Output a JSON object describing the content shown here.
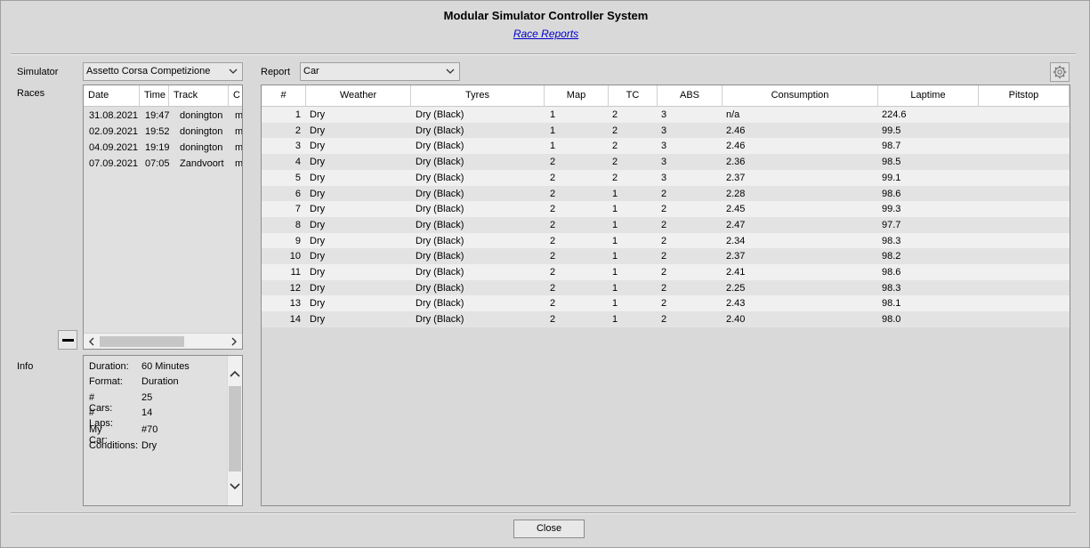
{
  "window": {
    "title": "Modular Simulator Controller System",
    "subtitle_link": "Race Reports"
  },
  "labels": {
    "simulator": "Simulator",
    "races": "Races",
    "info": "Info",
    "report": "Report"
  },
  "simulator_select": {
    "value": "Assetto Corsa Competizione"
  },
  "report_select": {
    "value": "Car"
  },
  "races": {
    "columns": [
      "Date",
      "Time",
      "Track",
      "C"
    ],
    "rows": [
      {
        "date": "31.08.2021",
        "time": "19:47",
        "track": "donington",
        "c": "m"
      },
      {
        "date": "02.09.2021",
        "time": "19:52",
        "track": "donington",
        "c": "m"
      },
      {
        "date": "04.09.2021",
        "time": "19:19",
        "track": "donington",
        "c": "m"
      },
      {
        "date": "07.09.2021",
        "time": "07:05",
        "track": "Zandvoort",
        "c": "m"
      }
    ]
  },
  "info": {
    "rows": [
      {
        "key": "Duration:",
        "value": "60 Minutes"
      },
      {
        "key": "Format:",
        "value": "Duration"
      },
      {
        "key": "# Cars:",
        "value": "25"
      },
      {
        "key": "# Laps:",
        "value": "14"
      },
      {
        "key": "My Car:",
        "value": "#70"
      },
      {
        "key": "Conditions:",
        "value": "Dry"
      }
    ]
  },
  "report_table": {
    "columns": [
      "#",
      "Weather",
      "Tyres",
      "Map",
      "TC",
      "ABS",
      "Consumption",
      "Laptime",
      "Pitstop"
    ],
    "rows": [
      [
        "1",
        "Dry",
        "Dry (Black)",
        "1",
        "2",
        "3",
        "n/a",
        "224.6",
        ""
      ],
      [
        "2",
        "Dry",
        "Dry (Black)",
        "1",
        "2",
        "3",
        "2.46",
        "99.5",
        ""
      ],
      [
        "3",
        "Dry",
        "Dry (Black)",
        "1",
        "2",
        "3",
        "2.46",
        "98.7",
        ""
      ],
      [
        "4",
        "Dry",
        "Dry (Black)",
        "2",
        "2",
        "3",
        "2.36",
        "98.5",
        ""
      ],
      [
        "5",
        "Dry",
        "Dry (Black)",
        "2",
        "2",
        "3",
        "2.37",
        "99.1",
        ""
      ],
      [
        "6",
        "Dry",
        "Dry (Black)",
        "2",
        "1",
        "2",
        "2.28",
        "98.6",
        ""
      ],
      [
        "7",
        "Dry",
        "Dry (Black)",
        "2",
        "1",
        "2",
        "2.45",
        "99.3",
        ""
      ],
      [
        "8",
        "Dry",
        "Dry (Black)",
        "2",
        "1",
        "2",
        "2.47",
        "97.7",
        ""
      ],
      [
        "9",
        "Dry",
        "Dry (Black)",
        "2",
        "1",
        "2",
        "2.34",
        "98.3",
        ""
      ],
      [
        "10",
        "Dry",
        "Dry (Black)",
        "2",
        "1",
        "2",
        "2.37",
        "98.2",
        ""
      ],
      [
        "11",
        "Dry",
        "Dry (Black)",
        "2",
        "1",
        "2",
        "2.41",
        "98.6",
        ""
      ],
      [
        "12",
        "Dry",
        "Dry (Black)",
        "2",
        "1",
        "2",
        "2.25",
        "98.3",
        ""
      ],
      [
        "13",
        "Dry",
        "Dry (Black)",
        "2",
        "1",
        "2",
        "2.43",
        "98.1",
        ""
      ],
      [
        "14",
        "Dry",
        "Dry (Black)",
        "2",
        "1",
        "2",
        "2.40",
        "98.0",
        ""
      ]
    ]
  },
  "buttons": {
    "close": "Close",
    "settings_icon": "gear-icon",
    "remove_icon": "minus-icon"
  }
}
